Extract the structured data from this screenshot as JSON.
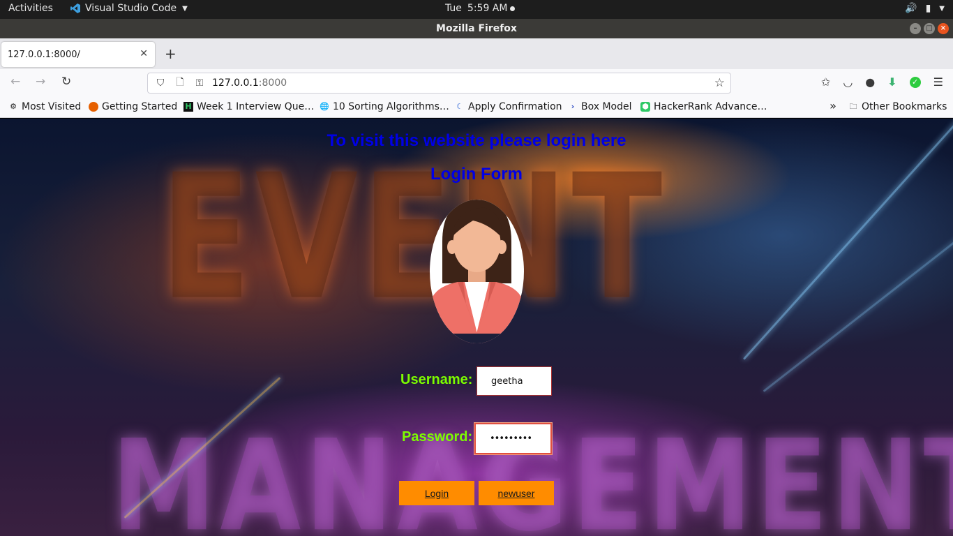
{
  "system_bar": {
    "activities": "Activities",
    "app_name": "Visual Studio Code",
    "day": "Tue",
    "time": "5:59 AM"
  },
  "window": {
    "title": "Mozilla Firefox"
  },
  "tabs": [
    {
      "label": "127.0.0.1:8000/"
    }
  ],
  "url_bar": {
    "host": "127.0.0.1",
    "port": ":8000"
  },
  "bookmarks": [
    {
      "label": "Most Visited",
      "icon": "gear-icon"
    },
    {
      "label": "Getting Started",
      "icon": "firefox-icon"
    },
    {
      "label": "Week 1 Interview Que…",
      "icon": "hackerrank-icon"
    },
    {
      "label": "10 Sorting Algorithms…",
      "icon": "globe-icon"
    },
    {
      "label": "Apply Confirmation",
      "icon": "moon-icon"
    },
    {
      "label": "Box Model",
      "icon": "prompt-icon"
    },
    {
      "label": "HackerRank Advance…",
      "icon": "shield-icon"
    },
    {
      "label": "Other Bookmarks",
      "icon": "folder-icon"
    }
  ],
  "page": {
    "notice": "To visit this website please login here",
    "form_title": "Login Form",
    "background_words": [
      "EVENT",
      "MANAGEMENT"
    ],
    "username_label": "Username:",
    "username_value": "geetha",
    "password_label": "Password:",
    "password_value": "•••••••••",
    "login_button": "Login",
    "newuser_button": "newuser"
  },
  "colors": {
    "heading": "#0000e6",
    "label": "#7cfc00",
    "button": "#ff8c00"
  }
}
